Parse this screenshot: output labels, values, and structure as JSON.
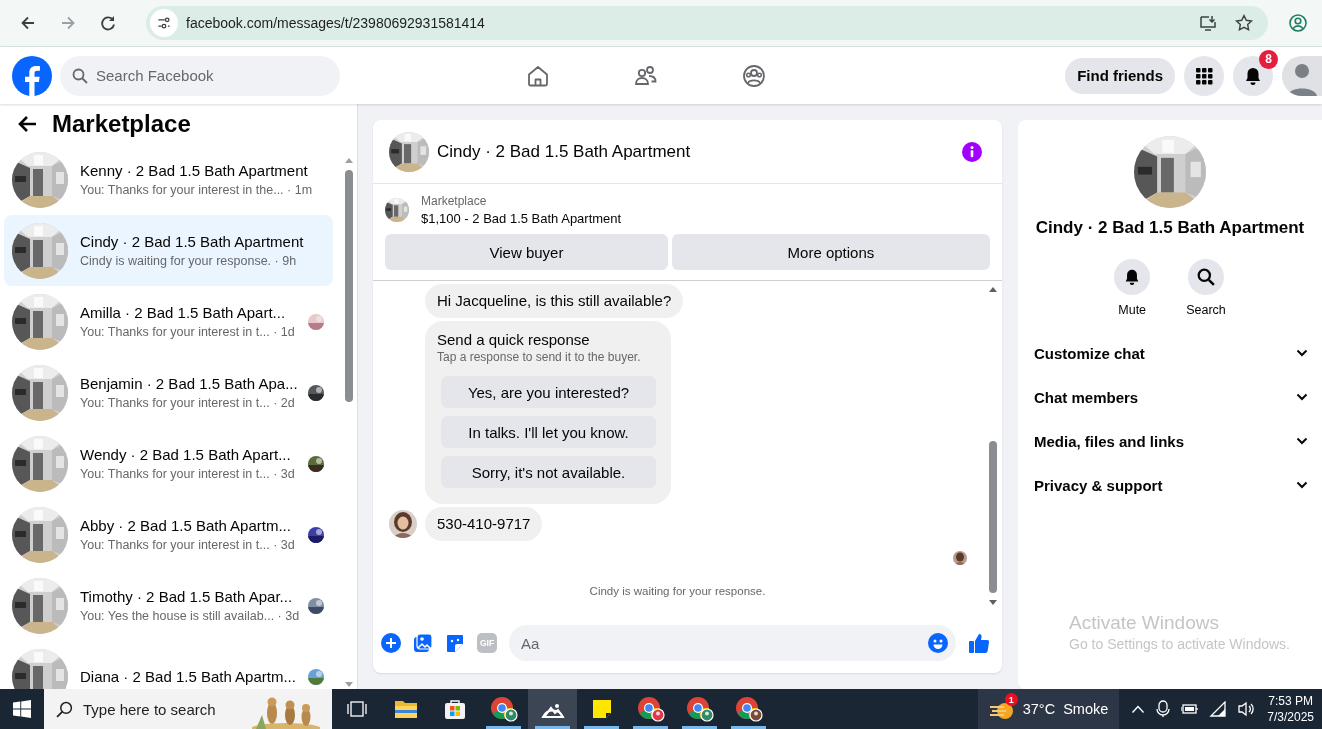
{
  "browser": {
    "url": "facebook.com/messages/t/23980692931581414"
  },
  "header": {
    "search_placeholder": "Search Facebook",
    "find_friends": "Find friends",
    "notification_count": "8"
  },
  "sidebar": {
    "title": "Marketplace",
    "conversations": [
      {
        "name": "Kenny · 2 Bad 1.5 Bath Apartment",
        "preview": "You: Thanks for your interest in the...",
        "time": "· 1m",
        "selected": false,
        "seen": false
      },
      {
        "name": "Cindy · 2 Bad 1.5 Bath Apartment",
        "preview": "Cindy is waiting for your response.",
        "time": "· 9h",
        "selected": true,
        "seen": false
      },
      {
        "name": "Amilla · 2 Bad 1.5 Bath Apart...",
        "preview": "You: Thanks for your interest in t...",
        "time": "· 1d",
        "selected": false,
        "seen": true
      },
      {
        "name": "Benjamin · 2 Bad 1.5 Bath Apa...",
        "preview": "You: Thanks for your interest in t...",
        "time": "· 2d",
        "selected": false,
        "seen": true
      },
      {
        "name": "Wendy · 2 Bad 1.5 Bath Apart...",
        "preview": "You: Thanks for your interest in t...",
        "time": "· 3d",
        "selected": false,
        "seen": true
      },
      {
        "name": "Abby · 2 Bad 1.5 Bath Apartm...",
        "preview": "You: Thanks for your interest in t...",
        "time": "· 3d",
        "selected": false,
        "seen": true
      },
      {
        "name": "Timothy · 2 Bad 1.5 Bath Apar...",
        "preview": "You: Yes the house is still availab...",
        "time": "· 3d",
        "selected": false,
        "seen": true
      },
      {
        "name": "Diana · 2 Bad 1.5 Bath Apartm...",
        "selected": false,
        "seen": true
      }
    ]
  },
  "chat": {
    "title": "Cindy · 2 Bad 1.5 Bath Apartment",
    "listing": {
      "label": "Marketplace",
      "title": "$1,100 - 2 Bad 1.5 Bath Apartment"
    },
    "buttons": [
      "View buyer",
      "More options"
    ],
    "messages": [
      {
        "kind": "text",
        "text": "Hi Jacqueline, is this still available?"
      },
      {
        "kind": "quick_responses",
        "title": "Send a quick response",
        "subtitle": "Tap a response to send it to the buyer.",
        "options": [
          "Yes, are you interested?",
          "In talks. I'll let you know.",
          "Sorry, it's not available."
        ]
      },
      {
        "kind": "avatar_text",
        "text": "530-410-9717"
      }
    ],
    "status": "Cindy is waiting for your response.",
    "composer_placeholder": "Aa",
    "gif_label": "GIF"
  },
  "details": {
    "name": "Cindy · 2 Bad 1.5 Bath Apartment",
    "actions": [
      {
        "kind": "bell",
        "label": "Mute"
      },
      {
        "kind": "search",
        "label": "Search"
      }
    ],
    "sections": [
      "Customize chat",
      "Chat members",
      "Media, files and links",
      "Privacy & support"
    ]
  },
  "windows_notice": {
    "title": "Activate Windows",
    "text": "Go to Settings to activate Windows."
  },
  "taskbar": {
    "search_placeholder": "Type here to search",
    "apps": [
      {
        "kind": "task_view",
        "running": false,
        "selected": false
      },
      {
        "kind": "folder",
        "running": false,
        "selected": false
      },
      {
        "kind": "store",
        "running": false,
        "selected": false
      },
      {
        "kind": "browser",
        "running": true,
        "selected": false
      },
      {
        "kind": "photos",
        "running": true,
        "selected": true
      },
      {
        "kind": "notes",
        "running": true,
        "selected": false
      },
      {
        "kind": "browser",
        "running": true,
        "selected": false
      },
      {
        "kind": "browser",
        "running": true,
        "selected": false
      },
      {
        "kind": "browser",
        "running": true,
        "selected": false
      }
    ],
    "weather": {
      "badge": "1",
      "temperature": "37°C",
      "condition": "Smoke"
    },
    "clock": {
      "time": "7:53 PM",
      "date": "7/3/2025"
    }
  }
}
